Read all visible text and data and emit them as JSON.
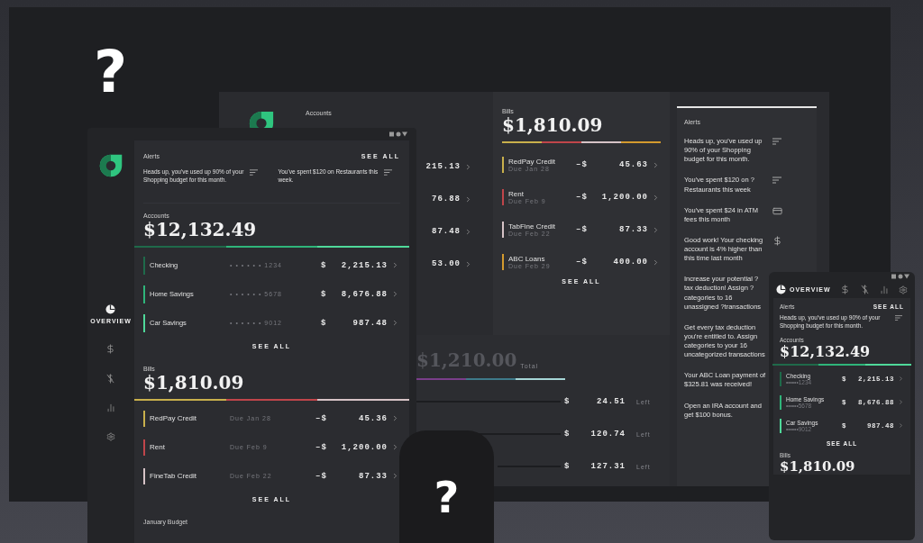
{
  "mystery_marks": [
    "?",
    "?"
  ],
  "desktop": {
    "accounts": {
      "title": "Accounts",
      "amounts": [
        "215.13",
        "76.88",
        "87.48",
        "53.00"
      ]
    },
    "bills": {
      "title": "Bills",
      "total": "$1,810.09",
      "see_all": "SEE ALL",
      "rows": [
        {
          "name": "RedPay Credit",
          "due": "Due Jan 28",
          "sign": "–$",
          "amount": "45.63",
          "color": "#c9b04c"
        },
        {
          "name": "Rent",
          "due": "Due Feb 9",
          "sign": "–$",
          "amount": "1,200.00",
          "color": "#c0454a"
        },
        {
          "name": "TabFine Credit",
          "due": "Due Feb 22",
          "sign": "–$",
          "amount": "87.33",
          "color": "#d6c3c6"
        },
        {
          "name": "ABC Loans",
          "due": "Due Feb 29",
          "sign": "–$",
          "amount": "400.00",
          "color": "#d49a2e"
        }
      ]
    },
    "alerts": {
      "title": "Alerts",
      "items": [
        {
          "text": "Heads up, you've used up 90% of your Shopping budget for this month.",
          "kind": "sort"
        },
        {
          "text": "You've spent $120 on ? Restaurants this week",
          "kind": "sort"
        },
        {
          "text": "You've spent $24 in ATM fees this month",
          "kind": "card"
        },
        {
          "text": "Good work! Your checking account is 4% higher than this time last month",
          "kind": "dollar"
        },
        {
          "text": "Increase your potential ? tax deduction! Assign ? categories to 16 unassigned ?transactions",
          "kind": "none"
        },
        {
          "text": "Get every tax deduction you're entitled to. Assign categories to your 16 uncategorized transactions",
          "kind": "none"
        },
        {
          "text": "Your ABC Loan payment of $325.81 was received!",
          "kind": "none"
        },
        {
          "text": "Open an IRA account and get $100 bonus.",
          "kind": "none"
        }
      ]
    },
    "budget": {
      "total": "$1,210.00",
      "total_label": "Total",
      "rows": [
        {
          "currency": "$",
          "amount": "24.51",
          "label": "Left"
        },
        {
          "currency": "$",
          "amount": "120.74",
          "label": "Left"
        },
        {
          "currency": "$",
          "amount": "127.31",
          "label": "Left"
        }
      ]
    }
  },
  "tablet": {
    "nav": [
      {
        "kind": "overview",
        "label": "OVERVIEW",
        "selected": true
      },
      {
        "kind": "dollar",
        "selected": false
      },
      {
        "kind": "transfer",
        "selected": false
      },
      {
        "kind": "chart",
        "selected": false
      },
      {
        "kind": "settings",
        "selected": false
      }
    ],
    "alerts": {
      "title": "Alerts",
      "see_all": "SEE ALL",
      "items": [
        "Heads up, you've used up 90% of your Shopping budget for this month.",
        "You've spent $120 on Restaurants this week."
      ]
    },
    "accounts": {
      "title": "Accounts",
      "total": "$12,132.49",
      "see_all": "SEE ALL",
      "rows": [
        {
          "name": "Checking",
          "number": "• • • • • • 1234",
          "currency": "$",
          "amount": "2,215.13",
          "color": "#1f6a4a"
        },
        {
          "name": "Home Savings",
          "number": "• • • • • • 5678",
          "currency": "$",
          "amount": "8,676.88",
          "color": "#2fb57a"
        },
        {
          "name": "Car Savings",
          "number": "• • • • • • 9012",
          "currency": "$",
          "amount": "987.48",
          "color": "#4fd99a"
        }
      ]
    },
    "bills": {
      "title": "Bills",
      "total": "$1,810.09",
      "see_all": "SEE ALL",
      "rows": [
        {
          "name": "RedPay Credit",
          "due": "Due Jan 28",
          "sign": "–$",
          "amount": "45.36",
          "color": "#c9b04c"
        },
        {
          "name": "Rent",
          "due": "Due Feb 9",
          "sign": "–$",
          "amount": "1,200.00",
          "color": "#c0454a"
        },
        {
          "name": "FineTab Credit",
          "due": "Due Feb 22",
          "sign": "–$",
          "amount": "87.33",
          "color": "#d6c3c6"
        }
      ]
    },
    "budget_title": "January Budget"
  },
  "phone": {
    "nav": [
      {
        "kind": "overview",
        "label": "OVERVIEW",
        "selected": true
      },
      {
        "kind": "dollar",
        "selected": false
      },
      {
        "kind": "transfer",
        "selected": false
      },
      {
        "kind": "chart",
        "selected": false
      },
      {
        "kind": "settings",
        "selected": false
      }
    ],
    "alerts": {
      "title": "Alerts",
      "see_all": "SEE ALL",
      "items": [
        "Heads up, you've used up 90% of your Shopping budget for this month."
      ]
    },
    "accounts": {
      "title": "Accounts",
      "total": "$12,132.49",
      "see_all": "SEE ALL",
      "rows": [
        {
          "name": "Checking",
          "number": "••••••1234",
          "currency": "$",
          "amount": "2,215.13",
          "color": "#1f6a4a"
        },
        {
          "name": "Home Savings",
          "number": "••••••5678",
          "currency": "$",
          "amount": "8,676.88",
          "color": "#2fb57a"
        },
        {
          "name": "Car Savings",
          "number": "••••••9012",
          "currency": "$",
          "amount": "987.48",
          "color": "#4fd99a"
        }
      ]
    },
    "bills": {
      "title": "Bills",
      "total": "$1,810.09"
    }
  }
}
